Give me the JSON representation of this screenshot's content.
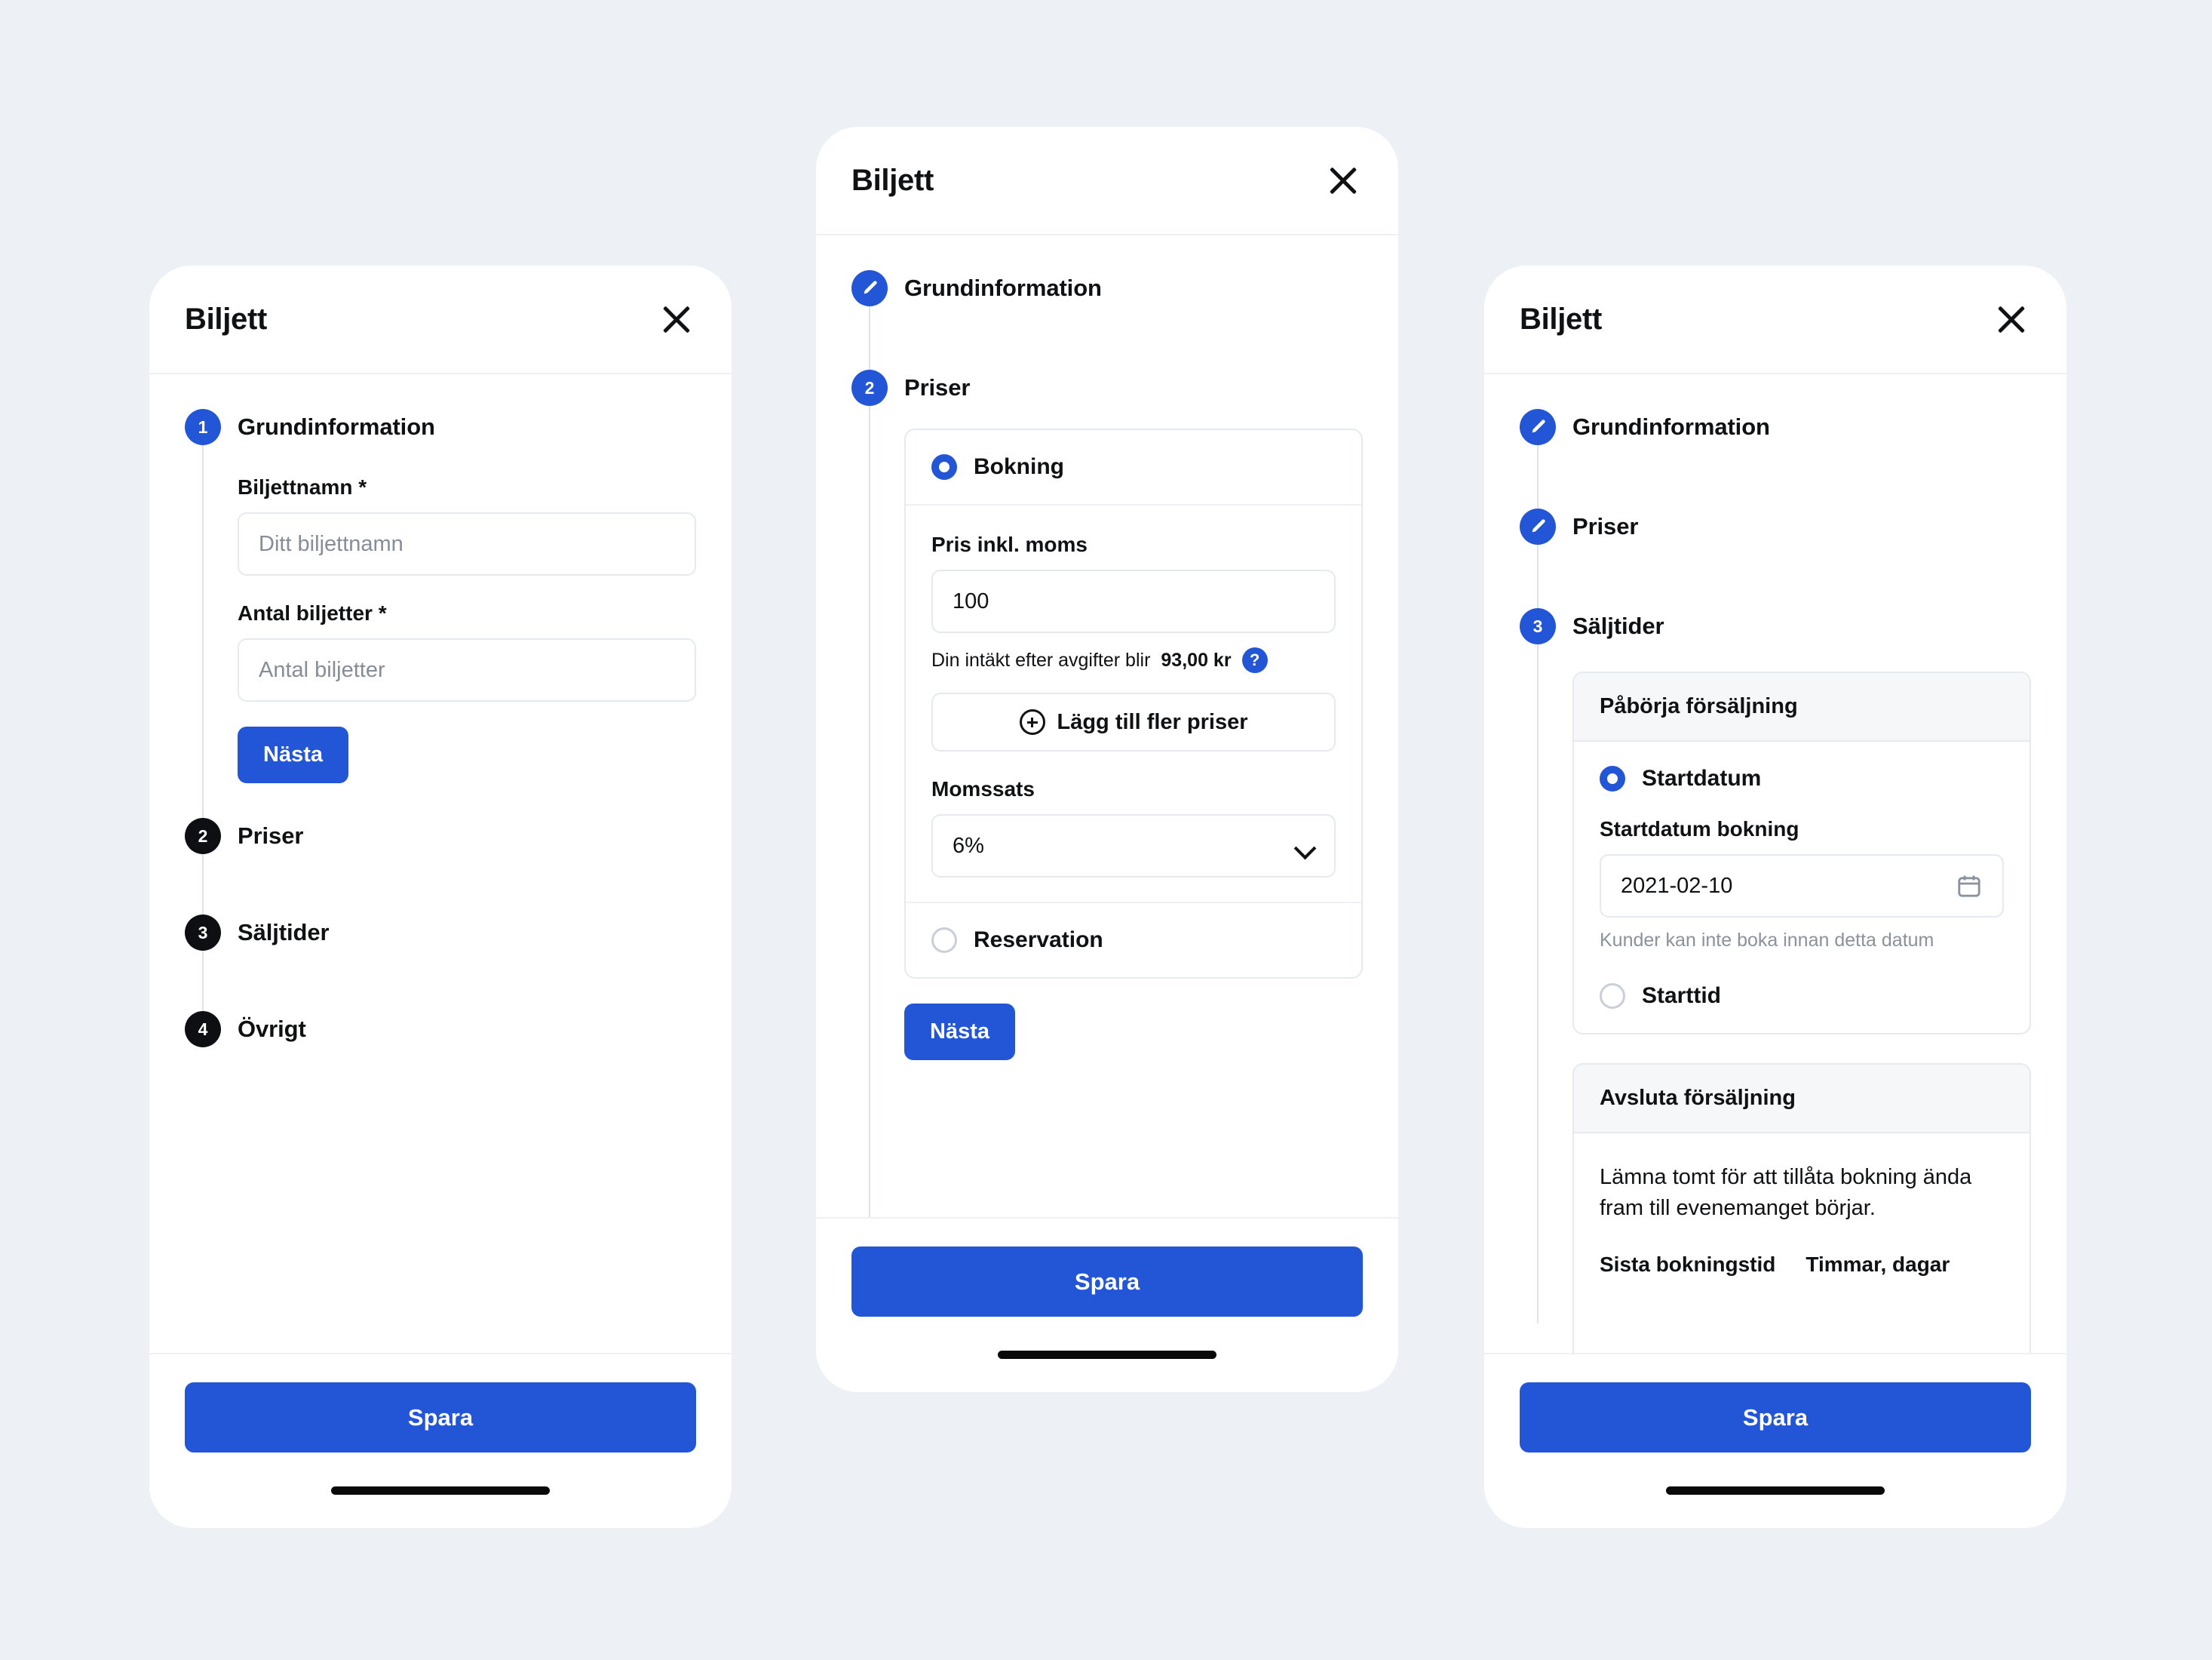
{
  "theme": {
    "page_bg": "#edf0f4",
    "accent_blue": "#2356d6",
    "step_dark": "#0d0f12",
    "text": "#101113",
    "muted": "#8b919d",
    "border": "#e6e9ee"
  },
  "phone1": {
    "title": "Biljett",
    "close_icon": "close-icon",
    "steps": [
      {
        "num": "1",
        "label": "Grundinformation",
        "state": "active"
      },
      {
        "num": "2",
        "label": "Priser",
        "state": "pending"
      },
      {
        "num": "3",
        "label": "Säljtider",
        "state": "pending"
      },
      {
        "num": "4",
        "label": "Övrigt",
        "state": "pending"
      }
    ],
    "form": {
      "name_label": "Biljettnamn *",
      "name_placeholder": "Ditt biljettnamn",
      "qty_label": "Antal biljetter *",
      "qty_placeholder": "Antal biljetter",
      "next_label": "Nästa"
    },
    "save_label": "Spara"
  },
  "phone2": {
    "title": "Biljett",
    "close_icon": "close-icon",
    "steps": [
      {
        "num": "",
        "label": "Grundinformation",
        "state": "done",
        "icon": "pencil-icon"
      },
      {
        "num": "2",
        "label": "Priser",
        "state": "active"
      }
    ],
    "pricing": {
      "option_booking": "Bokning",
      "option_booking_selected": true,
      "price_label": "Pris inkl. moms",
      "price_value": "100",
      "revenue_prefix": "Din intäkt efter avgifter blir",
      "revenue_amount": "93,00 kr",
      "help_icon": "question-mark-icon",
      "add_price_label": "Lägg till fler priser",
      "add_price_icon": "plus-circle-icon",
      "vat_label": "Momssats",
      "vat_value": "6%",
      "vat_chevron": "chevron-down-icon",
      "option_reservation": "Reservation",
      "option_reservation_selected": false
    },
    "next_label": "Nästa",
    "save_label": "Spara"
  },
  "phone3": {
    "title": "Biljett",
    "close_icon": "close-icon",
    "steps": [
      {
        "num": "",
        "label": "Grundinformation",
        "state": "done",
        "icon": "pencil-icon"
      },
      {
        "num": "",
        "label": "Priser",
        "state": "done",
        "icon": "pencil-icon"
      },
      {
        "num": "3",
        "label": "Säljtider",
        "state": "active"
      }
    ],
    "start_card": {
      "header": "Påbörja försäljning",
      "option_startdate": "Startdatum",
      "option_startdate_selected": true,
      "date_label": "Startdatum bokning",
      "date_value": "2021-02-10",
      "date_icon": "calendar-icon",
      "date_hint": "Kunder kan inte boka innan detta datum",
      "option_starttime": "Starttid",
      "option_starttime_selected": false
    },
    "end_card": {
      "header": "Avsluta försäljning",
      "description": "Lämna tomt för att tillåta bokning ända fram till evenemanget börjar.",
      "col1_label": "Sista bokningstid",
      "col2_label": "Timmar, dagar"
    },
    "save_label": "Spara"
  }
}
